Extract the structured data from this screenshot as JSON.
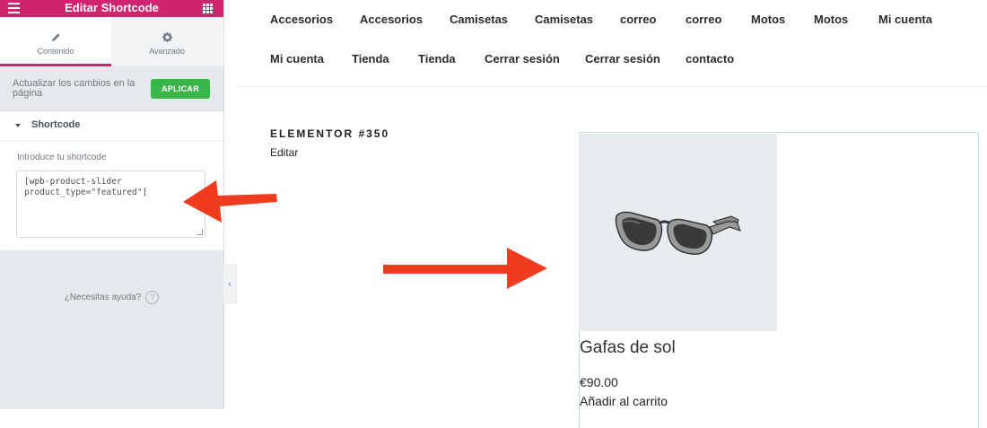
{
  "panel": {
    "header_title": "Editar Shortcode",
    "tabs": [
      {
        "label": "Contenido",
        "icon": "pencil-icon"
      },
      {
        "label": "Avanzado",
        "icon": "gear-icon"
      }
    ],
    "apply_text": "Actualizar los cambios en la página",
    "apply_button": "APLICAR",
    "section_title": "Shortcode",
    "shortcode_label": "Introduce tu shortcode",
    "shortcode_value": "[wpb-product-slider\nproduct_type=\"featured\"]",
    "help_text": "¿Necesitas ayuda?",
    "help_icon": "?"
  },
  "colors": {
    "brand": "#d0246f",
    "apply": "#39b54a",
    "arrow": "#f03c1e"
  },
  "nav": {
    "row1": [
      "Accesorios",
      "Accesorios",
      "Camisetas",
      "Camisetas",
      "correo",
      "correo",
      "Motos",
      "Motos",
      "Mi cuenta"
    ],
    "row2": [
      "Mi cuenta",
      "Tienda",
      "Tienda",
      "Cerrar sesión",
      "Cerrar sesión",
      "contacto"
    ]
  },
  "content": {
    "title": "ELEMENTOR #350",
    "edit": "Editar"
  },
  "product": {
    "name": "Gafas de sol",
    "price": "€90.00",
    "add_to_cart": "Añadir al carrito"
  }
}
